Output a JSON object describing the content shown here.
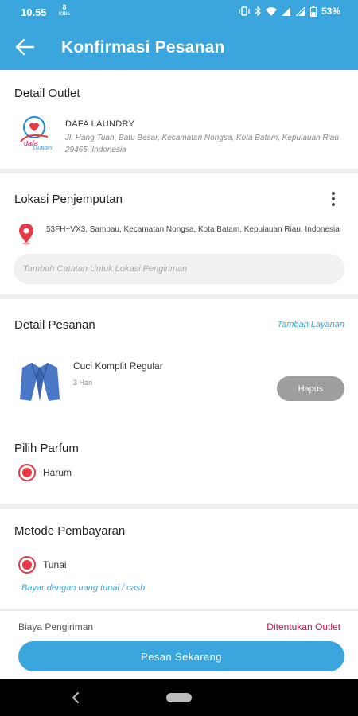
{
  "status_bar": {
    "time": "10.55",
    "speed_value": "8",
    "speed_unit": "KB/s",
    "battery": "53%"
  },
  "app_bar": {
    "title": "Konfirmasi Pesanan",
    "back_icon": "arrow-left-icon"
  },
  "outlet": {
    "heading": "Detail Outlet",
    "name": "DAFA LAUNDRY",
    "address": "Jl. Hang Tuah, Batu Besar, Kecamatan Nongsa, Kota Batam, Kepulauan Riau 29465, Indonesia",
    "logo_text": "LAUNDRY"
  },
  "pickup": {
    "heading": "Lokasi Penjemputan",
    "address": "53FH+VX3, Sambau, Kecamatan Nongsa, Kota Batam, Kepulauan Riau, Indonesia",
    "note_placeholder": "Tambah Catatan Untuk Lokasi Pengiriman"
  },
  "order": {
    "heading": "Detail Pesanan",
    "add_service_link": "Tambah Layanan",
    "items": [
      {
        "name": "Cuci Komplit Regular",
        "duration": "3 Hari",
        "remove_label": "Hapus"
      }
    ]
  },
  "perfume": {
    "heading": "Pilih Parfum",
    "selected": "Harum"
  },
  "payment": {
    "heading": "Metode Pembayaran",
    "selected": "Tunai",
    "hint": "Bayar dengan uang tunai / cash"
  },
  "footer": {
    "fee_label": "Biaya Pengiriman",
    "fee_value": "Ditentukan Outlet",
    "order_button": "Pesan Sekarang"
  },
  "colors": {
    "primary": "#3aa6dd",
    "radio_accent": "#e53945",
    "fee_value": "#b0174b",
    "remove_button": "#9e9e9e"
  }
}
